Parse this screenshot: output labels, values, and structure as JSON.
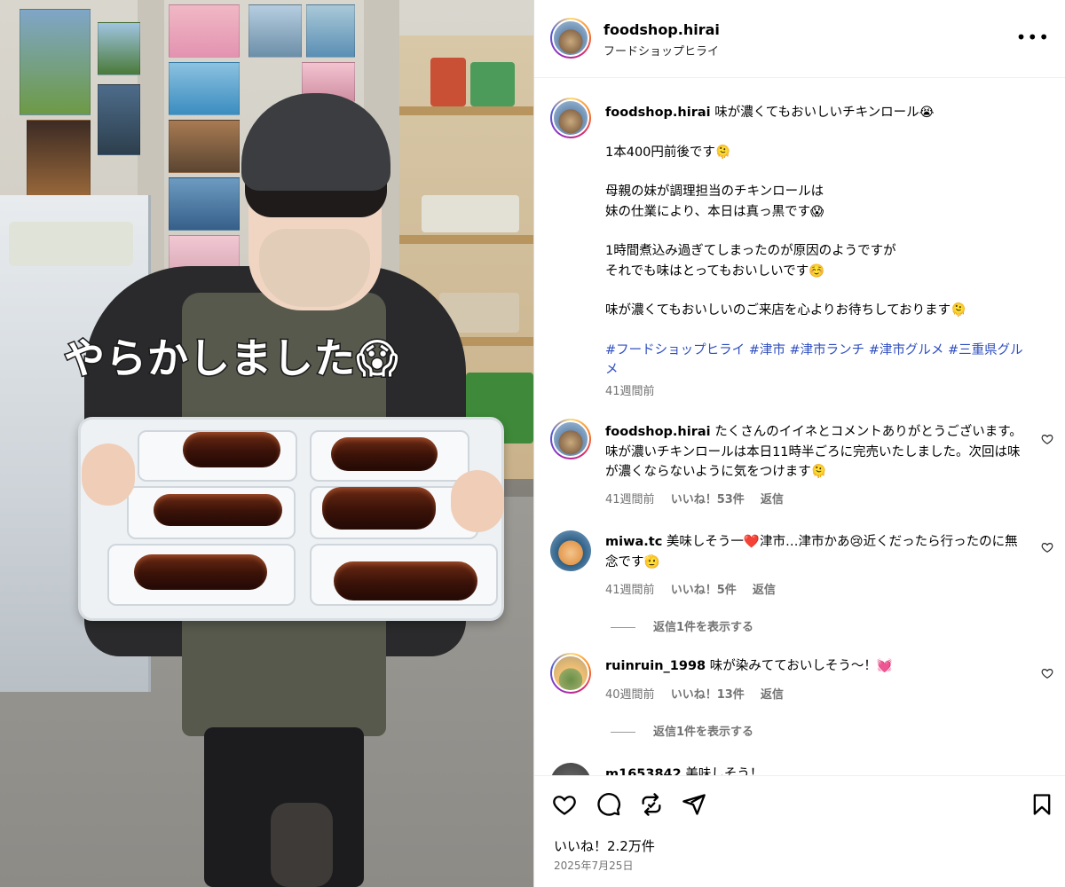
{
  "post": {
    "username": "foodshop.hirai",
    "subtitle": "フードショップヒライ",
    "overlay_text": "やらかしました😱",
    "caption": {
      "username": "foodshop.hirai",
      "lines": [
        "味が濃くてもおいしいチキンロール😭",
        "",
        "1本400円前後です🫠",
        "",
        "母親の妹が調理担当のチキンロールは",
        "妹の仕業により、本日は真っ黒です😱",
        "",
        "1時間煮込み過ぎてしまったのが原因のようですが",
        "それでも味はとってもおいしいです☺️",
        "",
        "味が濃くてもおいしいのご来店を心よりお待ちしております🫠"
      ],
      "hashtags": "#フードショップヒライ #津市 #津市ランチ #津市グルメ #三重県グルメ",
      "time": "41週間前"
    }
  },
  "comments": [
    {
      "username": "foodshop.hirai",
      "text": "たくさんのイイネとコメントありがとうございます。味が濃いチキンロールは本日11時半ごろに完売いたしました。次回は味が濃くならないように気をつけます🫠",
      "time": "41週間前",
      "likes": "いいね！53件",
      "reply": "返信"
    },
    {
      "username": "miwa.tc",
      "text": "美味しそう一❤️津市…津市かあ😢近くだったら行ったのに無念です🫡",
      "time": "41週間前",
      "likes": "いいね！5件",
      "reply": "返信",
      "view_replies": "返信1件を表示する"
    },
    {
      "username": "ruinruin_1998",
      "text": "味が染みてておいしそう〜！💓",
      "time": "40週間前",
      "likes": "いいね！13件",
      "reply": "返信",
      "view_replies": "返信1件を表示する"
    },
    {
      "username": "m1653842",
      "text": "美味しそう！"
    }
  ],
  "footer": {
    "likes": "いいね！2.2万件",
    "date": "2025年7月25日"
  },
  "icons": [
    "more-icon",
    "heart-icon",
    "comment-icon",
    "repost-icon",
    "share-icon",
    "bookmark-icon"
  ]
}
